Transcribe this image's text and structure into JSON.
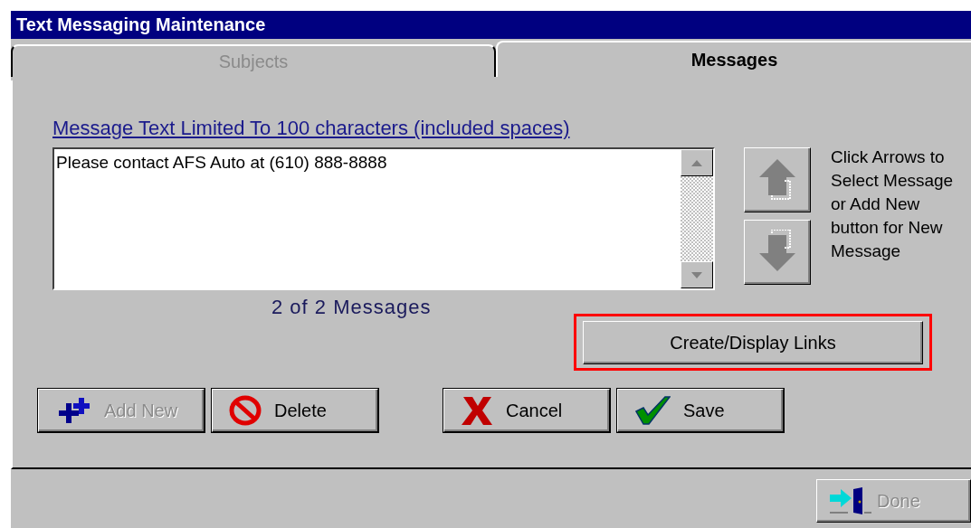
{
  "window": {
    "title": "Text Messaging Maintenance"
  },
  "tabs": [
    {
      "label": "Subjects",
      "selected": false
    },
    {
      "label": "Messages",
      "selected": true
    }
  ],
  "message_limit_label": "Message Text Limited To 100 characters (included spaces)",
  "message_text": {
    "value": "Please contact AFS Auto at (610) 888-8888"
  },
  "message_counter": "2 of 2 Messages",
  "arrow_buttons": [
    {
      "kind": "up"
    },
    {
      "kind": "down"
    }
  ],
  "instructions": "Click Arrows to Select Message or Add New button for New Message",
  "links_button": {
    "label": "Create/Display Links",
    "highlighted": true
  },
  "buttons": [
    {
      "kind": "add",
      "label": "Add New",
      "disabled": true
    },
    {
      "kind": "delete",
      "label": "Delete",
      "disabled": false
    },
    {
      "kind": "cancel",
      "label": "Cancel",
      "disabled": false
    },
    {
      "kind": "save",
      "label": "Save",
      "disabled": false
    }
  ],
  "done_button": {
    "label": "Done",
    "disabled": true
  }
}
